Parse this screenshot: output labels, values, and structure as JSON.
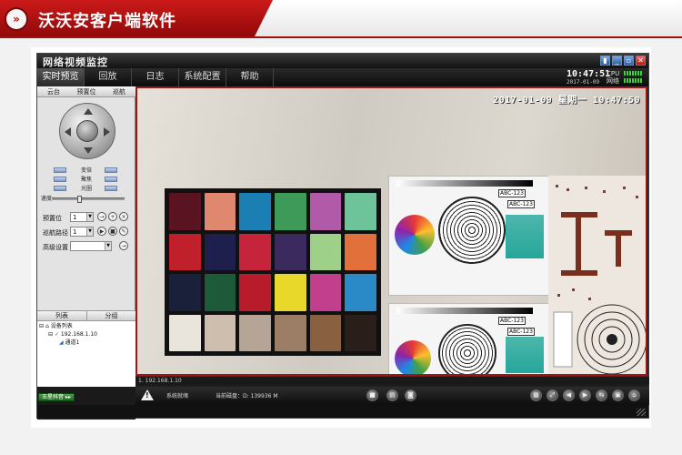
{
  "banner": {
    "bullet": "»",
    "title": "沃沃安客户端软件"
  },
  "window": {
    "title": "网络视频监控",
    "buttons": [
      "lock",
      "minimize",
      "restore",
      "close"
    ]
  },
  "menu": {
    "items": [
      {
        "label": "实时预览"
      },
      {
        "label": "回放"
      },
      {
        "label": "日志"
      },
      {
        "label": "系统配置"
      },
      {
        "label": "帮助"
      }
    ]
  },
  "clock": {
    "time": "10:47:51",
    "date": "2017-01-09"
  },
  "indicators": {
    "cpu_label": "CPU",
    "net_label": "网络"
  },
  "ptz": {
    "tabs": [
      {
        "label": "云台"
      },
      {
        "label": "预置位"
      },
      {
        "label": "巡航"
      }
    ],
    "controls": [
      {
        "label": "变倍"
      },
      {
        "label": "聚焦"
      },
      {
        "label": "光圈"
      }
    ],
    "speed_label": "速度",
    "preset": {
      "label": "预置位",
      "value": "1"
    },
    "cruise": {
      "label": "巡航路径",
      "value": "1"
    },
    "advanced": {
      "label": "高级设置"
    }
  },
  "device_panel": {
    "tabs": [
      {
        "label": "列表"
      },
      {
        "label": "分组"
      }
    ],
    "tree": {
      "root": "设备列表",
      "device": "192.168.1.10",
      "channel": "通道1"
    }
  },
  "screen_button": {
    "label": "五星抖音"
  },
  "video": {
    "osd_time": "2017-01-09 星期一 10:47:50",
    "camera_ip": "1. 192.168.1.10",
    "chart_labels": [
      "ABC-123",
      "ABC-123",
      "ABC-123",
      "ABC-123"
    ]
  },
  "status": {
    "system": "系统就绪",
    "disk": "当前磁盘：D: 139936 M"
  },
  "colors": {
    "banner_red": "#b01212",
    "accent_red": "#a01616",
    "app_dark": "#1e1e1e",
    "panel_gray": "#e3e3e3"
  }
}
